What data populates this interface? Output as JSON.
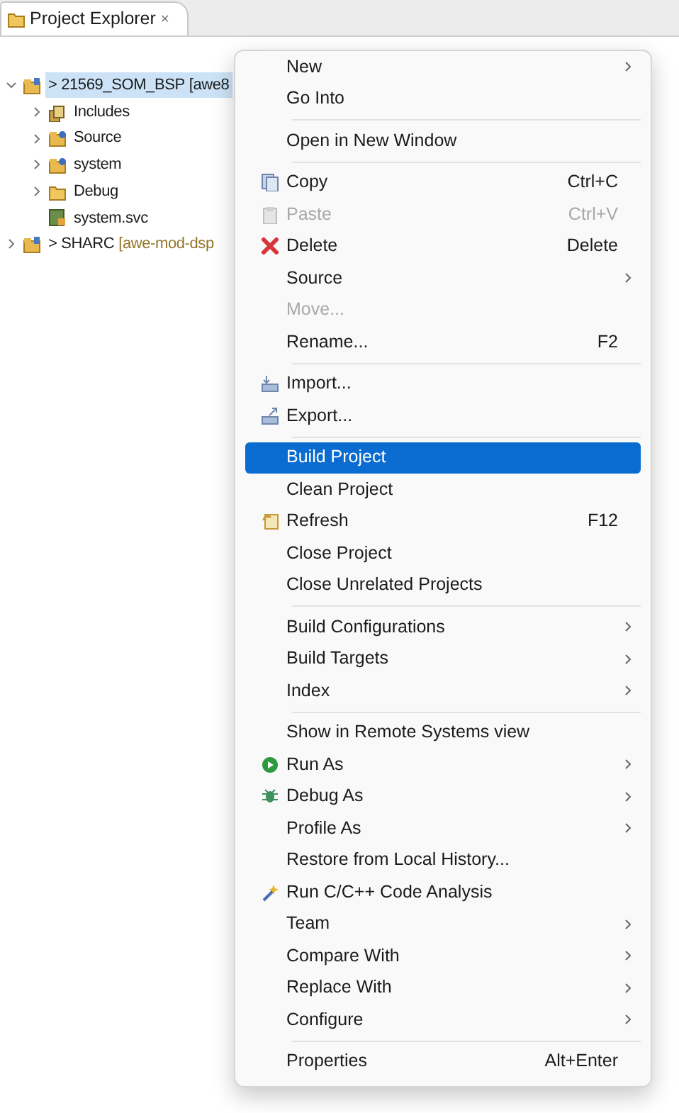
{
  "view_tab": {
    "title": "Project Explorer",
    "close": "✕"
  },
  "tree": [
    {
      "kind": "project",
      "name": "> 21569_SOM_BSP",
      "decoration": "[awe8",
      "expanded": true,
      "selected": true,
      "children": [
        {
          "kind": "library",
          "name": "Includes",
          "expanded": false,
          "selected": false
        },
        {
          "kind": "source-folder",
          "name": "Source",
          "expanded": false,
          "selected": false
        },
        {
          "kind": "source-folder",
          "name": "system",
          "expanded": false,
          "selected": false
        },
        {
          "kind": "folder",
          "name": "Debug",
          "expanded": false,
          "selected": false
        },
        {
          "kind": "file",
          "name": "system.svc",
          "selected": false
        }
      ]
    },
    {
      "kind": "project",
      "name": "> SHARC",
      "decoration": "[awe-mod-dsp",
      "expanded": false,
      "selected": false
    }
  ],
  "context_menu": [
    {
      "kind": "item",
      "label": "New",
      "submenu": true,
      "disabled": false,
      "selected": false
    },
    {
      "kind": "item",
      "label": "Go Into",
      "disabled": false,
      "selected": false
    },
    {
      "kind": "separator"
    },
    {
      "kind": "item",
      "label": "Open in New Window",
      "disabled": false,
      "selected": false
    },
    {
      "kind": "separator"
    },
    {
      "kind": "item",
      "label": "Copy",
      "shortcut": "Ctrl+C",
      "disabled": false,
      "selected": false
    },
    {
      "kind": "item",
      "label": "Paste",
      "shortcut": "Ctrl+V",
      "disabled": true,
      "selected": false
    },
    {
      "kind": "item",
      "label": "Delete",
      "shortcut": "Delete",
      "disabled": false,
      "selected": false
    },
    {
      "kind": "item",
      "label": "Source",
      "submenu": true,
      "disabled": false,
      "selected": false
    },
    {
      "kind": "item",
      "label": "Move...",
      "disabled": true,
      "selected": false
    },
    {
      "kind": "item",
      "label": "Rename...",
      "shortcut": "F2",
      "disabled": false,
      "selected": false
    },
    {
      "kind": "separator"
    },
    {
      "kind": "item",
      "label": "Import...",
      "disabled": false,
      "selected": false
    },
    {
      "kind": "item",
      "label": "Export...",
      "disabled": false,
      "selected": false
    },
    {
      "kind": "separator"
    },
    {
      "kind": "item",
      "label": "Build Project",
      "disabled": false,
      "selected": true
    },
    {
      "kind": "item",
      "label": "Clean Project",
      "disabled": false,
      "selected": false
    },
    {
      "kind": "item",
      "label": "Refresh",
      "shortcut": "F12",
      "disabled": false,
      "selected": false
    },
    {
      "kind": "item",
      "label": "Close Project",
      "disabled": false,
      "selected": false
    },
    {
      "kind": "item",
      "label": "Close Unrelated Projects",
      "disabled": false,
      "selected": false
    },
    {
      "kind": "separator"
    },
    {
      "kind": "item",
      "label": "Build Configurations",
      "submenu": true,
      "disabled": false,
      "selected": false
    },
    {
      "kind": "item",
      "label": "Build Targets",
      "submenu": true,
      "disabled": false,
      "selected": false
    },
    {
      "kind": "item",
      "label": "Index",
      "submenu": true,
      "disabled": false,
      "selected": false
    },
    {
      "kind": "separator"
    },
    {
      "kind": "item",
      "label": "Show in Remote Systems view",
      "disabled": false,
      "selected": false
    },
    {
      "kind": "item",
      "label": "Run As",
      "submenu": true,
      "disabled": false,
      "selected": false
    },
    {
      "kind": "item",
      "label": "Debug As",
      "submenu": true,
      "disabled": false,
      "selected": false
    },
    {
      "kind": "item",
      "label": "Profile As",
      "submenu": true,
      "disabled": false,
      "selected": false
    },
    {
      "kind": "item",
      "label": "Restore from Local History...",
      "disabled": false,
      "selected": false
    },
    {
      "kind": "item",
      "label": "Run C/C++ Code Analysis",
      "disabled": false,
      "selected": false
    },
    {
      "kind": "item",
      "label": "Team",
      "submenu": true,
      "disabled": false,
      "selected": false
    },
    {
      "kind": "item",
      "label": "Compare With",
      "submenu": true,
      "disabled": false,
      "selected": false
    },
    {
      "kind": "item",
      "label": "Replace With",
      "submenu": true,
      "disabled": false,
      "selected": false
    },
    {
      "kind": "item",
      "label": "Configure",
      "submenu": true,
      "disabled": false,
      "selected": false
    },
    {
      "kind": "separator"
    },
    {
      "kind": "item",
      "label": "Properties",
      "shortcut": "Alt+Enter",
      "disabled": false,
      "selected": false
    }
  ]
}
